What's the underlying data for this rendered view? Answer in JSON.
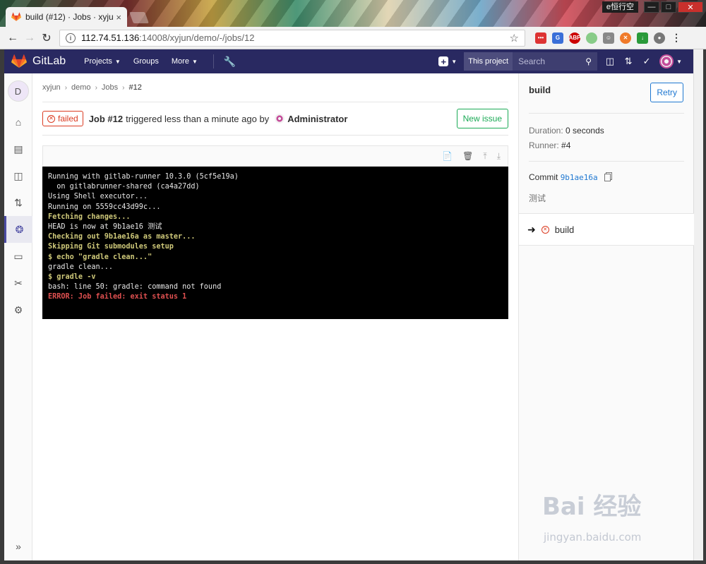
{
  "browser": {
    "tab_title": "build (#12) · Jobs · xyju",
    "tab_close": "×",
    "user_label": "e恒行空",
    "url_host": "112.74.51.136",
    "url_path": ":14008/xyjun/demo/-/jobs/12",
    "extensions": [
      "ABP"
    ]
  },
  "header": {
    "brand": "GitLab",
    "nav": [
      {
        "label": "Projects",
        "caret": true
      },
      {
        "label": "Groups",
        "caret": false
      },
      {
        "label": "More",
        "caret": true
      }
    ],
    "search_scope": "This project",
    "search_placeholder": "Search"
  },
  "sidebar": {
    "project_initial": "D",
    "active_item": "ci-cd",
    "collapse_label": "»"
  },
  "breadcrumb": [
    "xyjun",
    "demo",
    "Jobs",
    "#12"
  ],
  "job": {
    "status": "failed",
    "title": "Job #12",
    "triggered_text": "triggered less than a minute ago by",
    "user": "Administrator",
    "new_issue_label": "New issue"
  },
  "log_lines": [
    {
      "text": "Running with gitlab-runner 10.3.0 (5cf5e19a)",
      "style": ""
    },
    {
      "text": "  on gitlabrunner-shared (ca4a27dd)",
      "style": ""
    },
    {
      "text": "Using Shell executor...",
      "style": ""
    },
    {
      "text": "Running on 5559cc43d99c...",
      "style": ""
    },
    {
      "text": "Fetching changes...",
      "style": "g"
    },
    {
      "text": "HEAD is now at 9b1ae16 测试",
      "style": ""
    },
    {
      "text": "Checking out 9b1ae16a as master...",
      "style": "g"
    },
    {
      "text": "Skipping Git submodules setup",
      "style": "g"
    },
    {
      "text": "$ echo \"gradle clean...\"",
      "style": "g"
    },
    {
      "text": "gradle clean...",
      "style": ""
    },
    {
      "text": "$ gradle -v",
      "style": "g"
    },
    {
      "text": "bash: line 50: gradle: command not found",
      "style": ""
    },
    {
      "text": "ERROR: Job failed: exit status 1",
      "style": "r"
    }
  ],
  "right": {
    "job_name": "build",
    "retry_label": "Retry",
    "duration_label": "Duration:",
    "duration_value": "0 seconds",
    "runner_label": "Runner:",
    "runner_value": "#4",
    "commit_label": "Commit",
    "commit_sha": "9b1ae16a",
    "commit_message": "测试",
    "stage_job": "build"
  },
  "watermark": {
    "brand": "Bai 经验",
    "url": "jingyan.baidu.com"
  },
  "colors": {
    "header_bg": "#292961",
    "failed": "#db3b21",
    "success_button": "#1aaa55",
    "link": "#1f78d1"
  }
}
